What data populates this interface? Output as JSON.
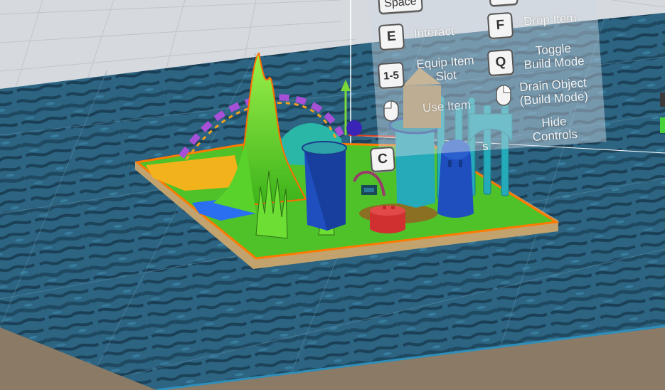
{
  "controls": {
    "space_key": "Space",
    "interact": {
      "key": "E",
      "label": "Interact"
    },
    "drop": {
      "key": "F",
      "label": "Drop Item"
    },
    "equip": {
      "key": "1-5",
      "label_line1": "Equip Item",
      "label_line2": "Slot"
    },
    "build": {
      "key": "Q",
      "label_line1": "Toggle",
      "label_line2": "Build Mode"
    },
    "use": {
      "icon": "mouse-left-click-icon",
      "label": "Use Item"
    },
    "drain": {
      "icon": "mouse-right-click-icon",
      "label_line1": "Drain Object",
      "label_line2": "(Build Mode)"
    },
    "c_key": {
      "key": "C",
      "label_fragment": "s"
    },
    "hide": {
      "label_line1": "Hide",
      "label_line2": "Controls"
    }
  },
  "colors": {
    "water": "#2b5f7a",
    "terrain_grass": "#58d62a",
    "terrain_outline": "#ff7a00",
    "tower_blue": "#1f4fbf",
    "tower_teal": "#25aab9",
    "tower_red": "#d03030",
    "purple_path": "#a650d8"
  }
}
